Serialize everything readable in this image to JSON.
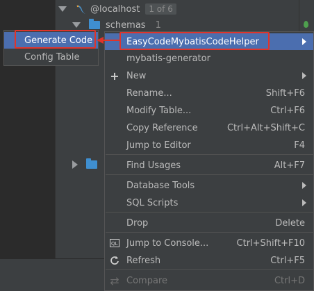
{
  "tree": {
    "host": {
      "label": "@localhost",
      "badge": "1 of 6"
    },
    "schemas": {
      "label": "schemas",
      "badge": "1"
    }
  },
  "submenu": {
    "items": [
      {
        "label": "Generate Code",
        "selected": true
      },
      {
        "label": "Config Table",
        "selected": false
      }
    ]
  },
  "menu": {
    "items": [
      {
        "label": "EasyCodeMybatisCodeHelper",
        "shortcut": "",
        "submenu": true,
        "selected": true
      },
      {
        "label": "mybatis-generator",
        "shortcut": "",
        "submenu": false
      },
      {
        "label": "New",
        "shortcut": "",
        "submenu": true,
        "icon": "plus-icon"
      },
      {
        "label": "Rename...",
        "shortcut": "Shift+F6"
      },
      {
        "label": "Modify Table...",
        "shortcut": "Ctrl+F6"
      },
      {
        "label": "Copy Reference",
        "shortcut": "Ctrl+Alt+Shift+C"
      },
      {
        "label": "Jump to Editor",
        "shortcut": "F4"
      },
      {
        "label": "Find Usages",
        "shortcut": "Alt+F7"
      },
      {
        "label": "Database Tools",
        "shortcut": "",
        "submenu": true
      },
      {
        "label": "SQL Scripts",
        "shortcut": "",
        "submenu": true
      },
      {
        "label": "Drop",
        "shortcut": "Delete"
      },
      {
        "label": "Jump to Console...",
        "shortcut": "Ctrl+Shift+F10",
        "icon": "console-icon"
      },
      {
        "label": "Refresh",
        "shortcut": "Ctrl+F5",
        "icon": "refresh-icon"
      },
      {
        "label": "Compare",
        "shortcut": "Ctrl+D",
        "icon": "compare-icon",
        "disabled": true
      }
    ]
  },
  "colors": {
    "background": "#3c3f41",
    "selection": "#4b6eaf",
    "highlight_box": "#e0342b",
    "folder": "#3f8fd0"
  }
}
